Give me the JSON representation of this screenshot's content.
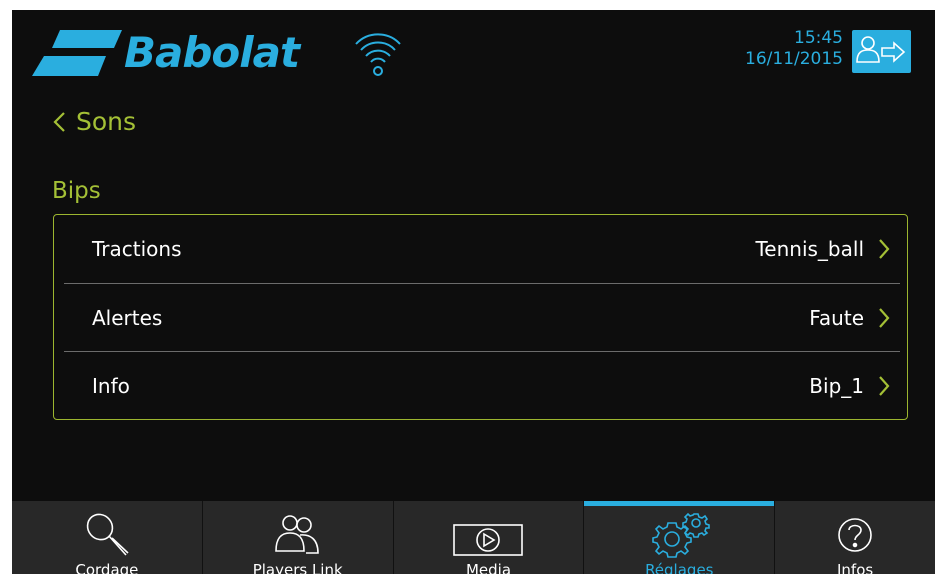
{
  "header": {
    "brand": "Babolat",
    "time": "15:45",
    "date": "16/11/2015",
    "logout_icon": "user-logout-icon",
    "wifi_icon": "wifi-icon"
  },
  "page": {
    "back_label": "Sons",
    "section_title": "Bips"
  },
  "settings": [
    {
      "label": "Tractions",
      "value": "Tennis_ball"
    },
    {
      "label": "Alertes",
      "value": "Faute"
    },
    {
      "label": "Info",
      "value": "Bip_1"
    }
  ],
  "nav": {
    "items": [
      {
        "label": "Cordage",
        "icon": "racket-icon",
        "active": false
      },
      {
        "label": "Players Link",
        "icon": "players-icon",
        "active": false
      },
      {
        "label": "Media",
        "icon": "play-icon",
        "active": false
      },
      {
        "label": "Réglages",
        "icon": "gears-icon",
        "active": true
      },
      {
        "label": "Infos",
        "icon": "help-icon",
        "active": false
      }
    ]
  },
  "colors": {
    "accent_blue": "#2aaedf",
    "accent_green": "#a4c036",
    "background": "#0d0d0d",
    "nav_background": "#282828"
  }
}
